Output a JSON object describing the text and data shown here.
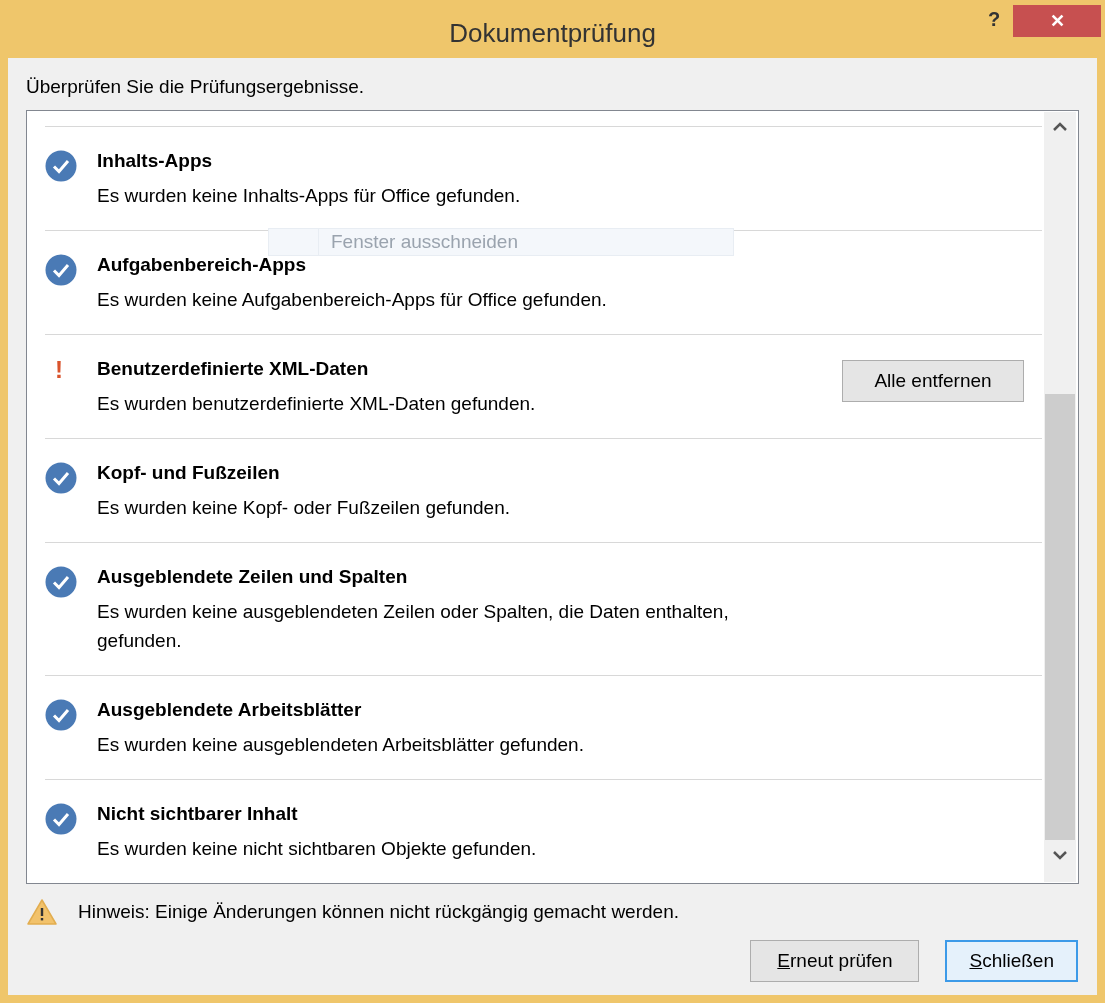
{
  "window": {
    "title": "Dokumentprüfung",
    "help": "?",
    "close": "✕"
  },
  "instruction": "Überprüfen Sie die Prüfungsergebnisse.",
  "ghost_field": {
    "placeholder": "Fenster ausschneiden"
  },
  "results": [
    {
      "kind": "ok",
      "title": "Inhalts-Apps",
      "description": "Es wurden keine Inhalts-Apps für Office gefunden."
    },
    {
      "kind": "ok",
      "title": "Aufgabenbereich-Apps",
      "description": "Es wurden keine Aufgabenbereich-Apps für Office gefunden."
    },
    {
      "kind": "issue",
      "title": "Benutzerdefinierte XML-Daten",
      "description": "Es wurden benutzerdefinierte XML-Daten gefunden.",
      "icon_text": "!",
      "action": "Alle entfernen"
    },
    {
      "kind": "ok",
      "title": "Kopf- und Fußzeilen",
      "description": "Es wurden keine Kopf- oder Fußzeilen gefunden."
    },
    {
      "kind": "ok",
      "title": "Ausgeblendete Zeilen und Spalten",
      "description": "Es wurden keine ausgeblendeten Zeilen oder Spalten, die Daten enthalten, gefunden."
    },
    {
      "kind": "ok",
      "title": "Ausgeblendete Arbeitsblätter",
      "description": "Es wurden keine ausgeblendeten Arbeitsblätter gefunden."
    },
    {
      "kind": "ok",
      "title": "Nicht sichtbarer Inhalt",
      "description": "Es wurden keine nicht sichtbaren Objekte gefunden."
    }
  ],
  "warning": "Hinweis: Einige Änderungen können nicht rückgängig gemacht werden.",
  "buttons": [
    {
      "label": "Erneut prüfen",
      "underline_first": true,
      "selected": false
    },
    {
      "label": "Schließen",
      "underline_first": true,
      "selected": true
    }
  ]
}
